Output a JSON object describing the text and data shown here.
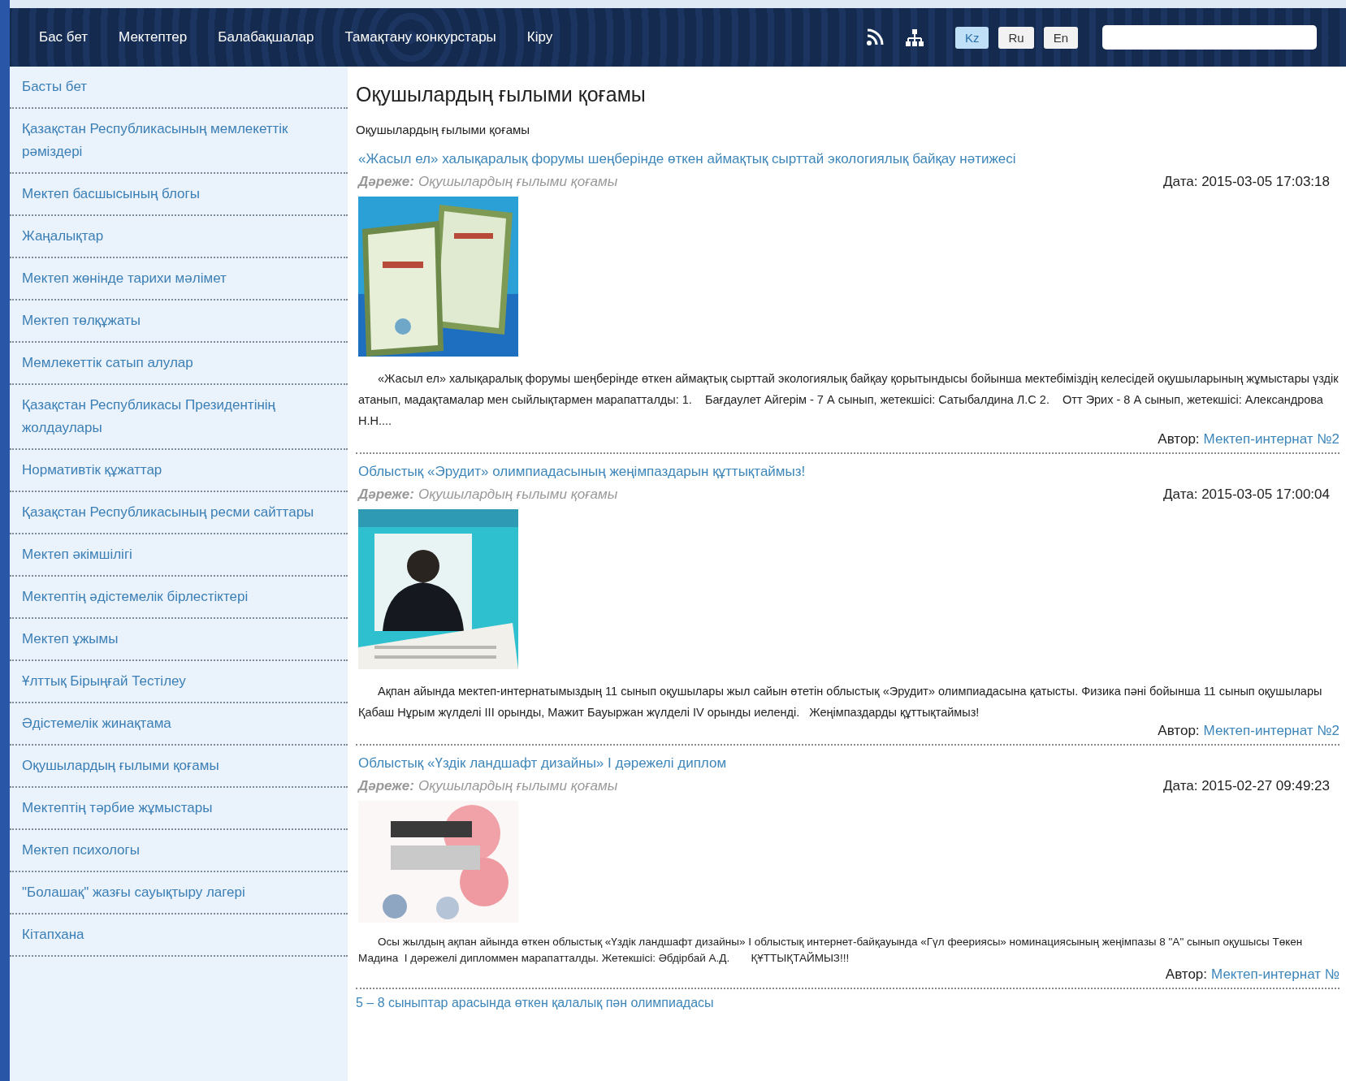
{
  "nav": {
    "links": [
      {
        "label": "Бас бет"
      },
      {
        "label": "Мектептер"
      },
      {
        "label": "Балабақшалар"
      },
      {
        "label": "Тамақтану конкурстары"
      },
      {
        "label": "Кіру"
      }
    ],
    "languages": [
      {
        "label": "Kz",
        "selected": true
      },
      {
        "label": "Ru",
        "selected": false
      },
      {
        "label": "En",
        "selected": false
      }
    ]
  },
  "sidebar": {
    "items": [
      {
        "label": "Басты бет"
      },
      {
        "label": "Қазақстан Республикасының мемлекеттік рәміздері"
      },
      {
        "label": "Мектеп басшысының блогы"
      },
      {
        "label": "Жаңалықтар"
      },
      {
        "label": "Мектеп жөнінде тарихи мәлімет"
      },
      {
        "label": "Мектеп төлқұжаты"
      },
      {
        "label": "Мемлекеттік сатып алулар"
      },
      {
        "label": "Қазақстан Республикасы Президентінің жолдаулары"
      },
      {
        "label": "Нормативтік құжаттар"
      },
      {
        "label": "Қазақстан Республикасының ресми сайттары"
      },
      {
        "label": "Мектеп әкімшілігі"
      },
      {
        "label": "Мектептің әдістемелік бірлестіктері"
      },
      {
        "label": "Мектеп ұжымы"
      },
      {
        "label": "Ұлттық Бірыңғай Тестілеу"
      },
      {
        "label": "Әдістемелік жинақтама"
      },
      {
        "label": "Оқушылардың ғылыми қоғамы"
      },
      {
        "label": "Мектептің тәрбие жұмыстары"
      },
      {
        "label": "Мектеп психологы"
      },
      {
        "label": "\"Болашақ\" жазғы сауықтыру лагері"
      },
      {
        "label": "Кітапхана"
      }
    ]
  },
  "main": {
    "title": "Оқушылардың ғылыми қоғамы",
    "subtitle": "Оқушылардың ғылыми қоғамы",
    "articles": [
      {
        "title": "«Жасыл ел» халықаралық форумы шеңберінде өткен аймақтық сырттай экологиялық байқау нәтижесі",
        "category_label": "Дәреже:",
        "category": "Оқушылардың ғылыми қоғамы",
        "date": "Дата: 2015-03-05 17:03:18",
        "body": "«Жасыл ел» халықаралық форумы шеңберінде өткен аймақтық сырттай экологиялық байқау қорытындысы бойынша мектебіміздің келесідей оқушыларының жұмыстары үздік атанып, мадақтамалар мен сыйлықтармен марапатталды: 1.    Бағдаулет Айгерім - 7 А сынып, жетекшісі: Сатыбалдина Л.С 2.    Отт Эрих - 8 А сынып, жетекшісі: Александрова Н.Н....",
        "author_label": "Автор:",
        "author": "Мектеп-интернат №2"
      },
      {
        "title": "Облыстық «Эрудит» олимпиадасының жеңімпаздарын құттықтаймыз!",
        "category_label": "Дәреже:",
        "category": "Оқушылардың ғылыми қоғамы",
        "date": "Дата: 2015-03-05 17:00:04",
        "body": "Ақпан айында мектеп-интернатымыздың 11 сынып оқушылары жыл сайын өтетін облыстық «Эрудит» олимпиадасына қатысты. Физика пәні бойынша 11 сынып оқушылары Қабаш Нұрым жүлделі ІІІ орынды, Мажит Бауыржан жүлделі ІV орынды иеленді.   Жеңімпаздарды құттықтаймыз!",
        "author_label": "Автор:",
        "author": "Мектеп-интернат №2"
      },
      {
        "title": "Облыстық «Үздік ландшафт дизайны» І дәрежелі диплом",
        "category_label": "Дәреже:",
        "category": "Оқушылардың ғылыми қоғамы",
        "date": "Дата: 2015-02-27 09:49:23",
        "body": "Осы жылдың ақпан айында өткен облыстық «Үздік ландшафт дизайны» І облыстық интернет-байқауында «Гүл феериясы» номинациясының жеңімпазы 8 \"А\" сынып оқушысы Төкен Мадина  І дәрежелі дипломмен марапатталды. Жетекшісі: Әбдірбай А.Д.       ҚҰТТЫҚТАЙМЫЗ!!!",
        "author_label": "Автор:",
        "author": "Мектеп-интернат №"
      }
    ],
    "next_title": "5 – 8 сыныптар арасында өткен қалалық пән олимпиадасы"
  }
}
